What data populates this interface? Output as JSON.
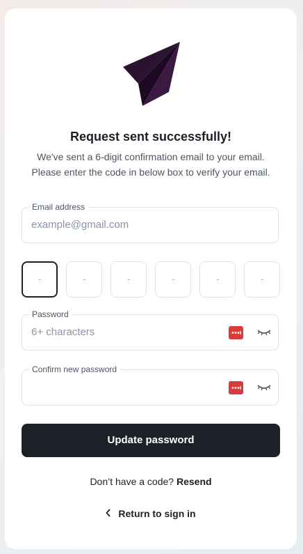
{
  "header": {
    "icon": "paper-plane-icon",
    "title": "Request sent successfully!",
    "description_line1": "We've sent a 6-digit confirmation email to your email.",
    "description_line2": "Please enter the code in below box to verify your email."
  },
  "email_field": {
    "label": "Email address",
    "placeholder": "example@gmail.com",
    "value": ""
  },
  "code_inputs": [
    "-",
    "-",
    "-",
    "-",
    "-",
    "-"
  ],
  "password_field": {
    "label": "Password",
    "placeholder": "6+ characters",
    "value": ""
  },
  "confirm_field": {
    "label": "Confirm new password",
    "placeholder": "",
    "value": ""
  },
  "submit": {
    "label": "Update password"
  },
  "resend": {
    "prompt": "Don’t have a code?",
    "link": "Resend"
  },
  "back": {
    "label": "Return to sign in",
    "icon": "chevron-left-icon"
  },
  "colors": {
    "primary": "#1c2128",
    "accent_red": "#d93a3a",
    "plane": "#2a1230"
  }
}
